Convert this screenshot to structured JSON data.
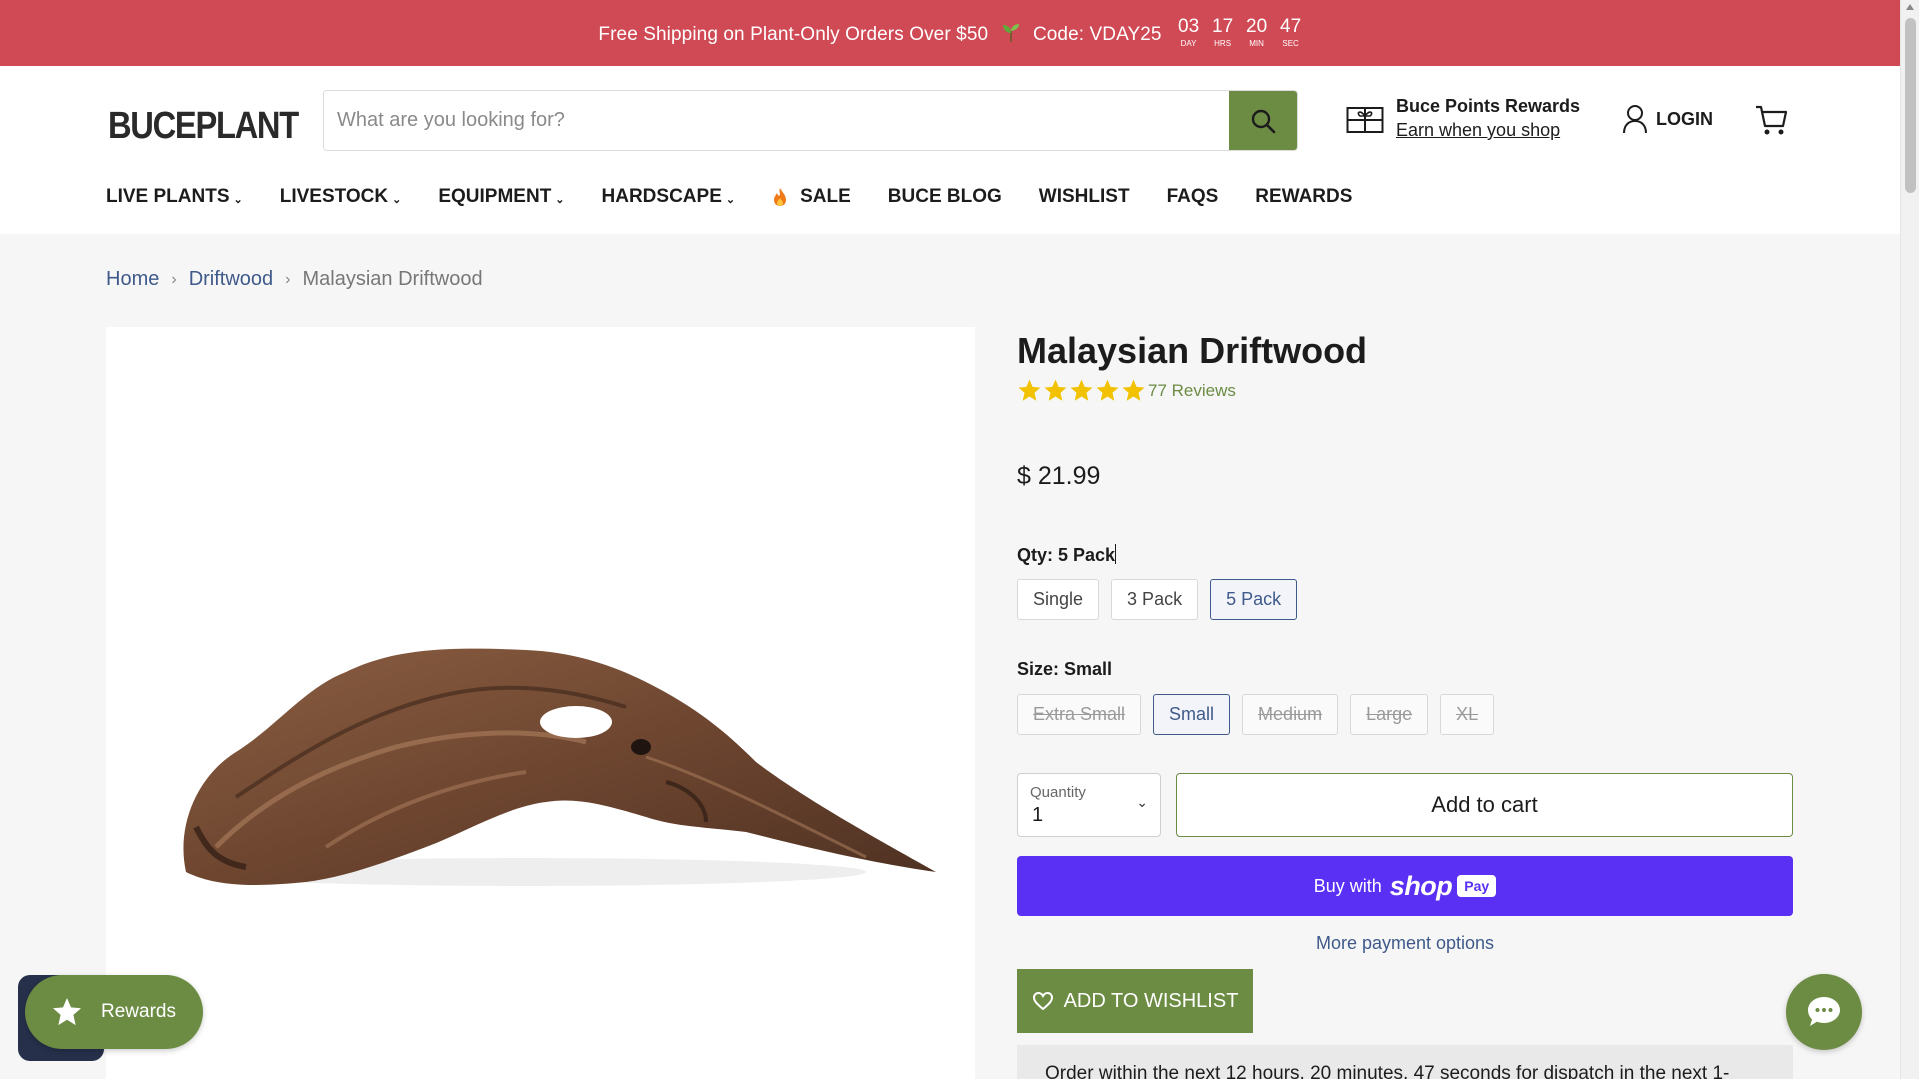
{
  "announcement": {
    "text_before": "Free Shipping on Plant-Only Orders Over $50",
    "text_after": "Code: VDAY25",
    "countdown": [
      {
        "value": "03",
        "label": "DAY"
      },
      {
        "value": "17",
        "label": "HRS"
      },
      {
        "value": "20",
        "label": "MIN"
      },
      {
        "value": "47",
        "label": "SEC"
      }
    ],
    "bg_color": "#d04a56"
  },
  "header": {
    "logo_text": "BUCEPLANT",
    "search_placeholder": "What are you looking for?",
    "rewards_title": "Buce Points Rewards",
    "rewards_subtitle": "Earn when you shop",
    "login_label": "LOGIN",
    "accent_color": "#6c8c44"
  },
  "nav": {
    "items": [
      {
        "label": "LIVE PLANTS",
        "has_dropdown": true
      },
      {
        "label": "LIVESTOCK",
        "has_dropdown": true
      },
      {
        "label": "EQUIPMENT",
        "has_dropdown": true
      },
      {
        "label": "HARDSCAPE",
        "has_dropdown": true
      },
      {
        "label": "SALE",
        "icon": "flame-icon"
      },
      {
        "label": "BUCE BLOG"
      },
      {
        "label": "WISHLIST"
      },
      {
        "label": "FAQS"
      },
      {
        "label": "REWARDS"
      }
    ]
  },
  "breadcrumb": {
    "home": "Home",
    "category": "Driftwood",
    "current": "Malaysian Driftwood"
  },
  "product": {
    "title": "Malaysian Driftwood",
    "rating": 5,
    "reviews_label": "77 Reviews",
    "price": "$ 21.99",
    "qty_option": {
      "label": "Qty:",
      "selected": "5 Pack",
      "options": [
        "Single",
        "3 Pack",
        "5 Pack"
      ]
    },
    "size_option": {
      "label": "Size:",
      "selected": "Small",
      "options": [
        "Extra Small",
        "Small",
        "Medium",
        "Large",
        "XL"
      ],
      "unavailable": [
        "Extra Small",
        "Medium",
        "Large",
        "XL"
      ]
    },
    "quantity_label": "Quantity",
    "quantity_value": "1",
    "add_to_cart": "Add to cart",
    "shop_pay": {
      "buy_with": "Buy with",
      "shop": "shop",
      "pay": "Pay",
      "color": "#5a31f4"
    },
    "more_payment": "More payment options",
    "add_to_wishlist": "ADD TO WISHLIST",
    "dispatch_text": "Order within the next 12 hours, 20 minutes, 47 seconds for dispatch in the next 1-"
  },
  "widgets": {
    "rewards_label": "Rewards"
  }
}
